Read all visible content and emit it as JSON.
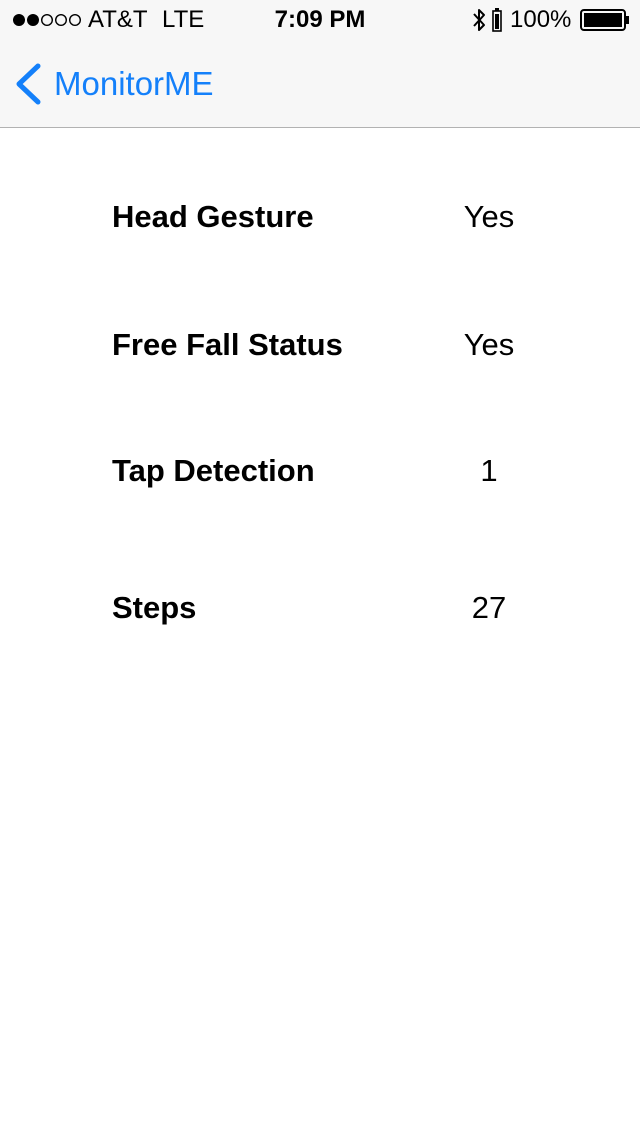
{
  "status_bar": {
    "carrier": "AT&T",
    "network": "LTE",
    "time": "7:09 PM",
    "battery_percent": "100%",
    "signal_bars_filled": 2,
    "signal_bars_total": 5,
    "battery_level": 1.0,
    "icons": [
      "signal-dots-icon",
      "bluetooth-icon",
      "charging-icon",
      "battery-icon"
    ]
  },
  "nav": {
    "back_label": "MonitorME",
    "back_icon": "chevron-left-icon",
    "accent_color": "#1480fa"
  },
  "rows": [
    {
      "label": "Head Gesture",
      "value": "Yes"
    },
    {
      "label": "Free Fall Status",
      "value": "Yes"
    },
    {
      "label": "Tap Detection",
      "value": "1"
    },
    {
      "label": "Steps",
      "value": "27"
    }
  ]
}
